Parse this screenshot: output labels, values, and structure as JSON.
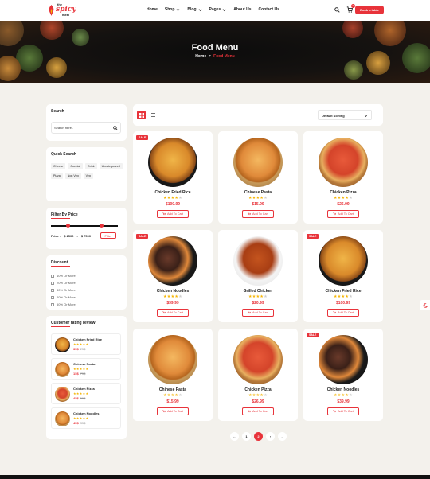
{
  "brand": {
    "line1": "the",
    "line2": "spicy",
    "line3": "meal"
  },
  "nav": [
    {
      "label": "Home",
      "dropdown": false
    },
    {
      "label": "Shop",
      "dropdown": true
    },
    {
      "label": "Blog",
      "dropdown": true
    },
    {
      "label": "Pages",
      "dropdown": true
    },
    {
      "label": "About Us",
      "dropdown": false
    },
    {
      "label": "Contact Us",
      "dropdown": false
    }
  ],
  "header": {
    "cart_count": "0",
    "book_label": "Book a table"
  },
  "hero": {
    "title": "Food Menu",
    "crumb_home": "Home",
    "crumb_sep": ">",
    "crumb_current": "Food Menu"
  },
  "sidebar": {
    "search": {
      "title": "Search",
      "placeholder": "Search here.."
    },
    "quick": {
      "title": "Quick Search",
      "tags": [
        "Cheese",
        "Cocktail",
        "Drink",
        "Uncategorized",
        "Pizza",
        "Non Veg",
        "Veg"
      ]
    },
    "price": {
      "title": "Filter By Price",
      "label": "Price :",
      "min": "$ 2500",
      "dash": "-",
      "max": "$ 7500",
      "min_fraction": 0.25,
      "max_fraction": 0.75,
      "button": "Filter"
    },
    "discount": {
      "title": "Discount",
      "items": [
        "10% Or More",
        "20% Or More",
        "30% Or More",
        "40% Or More",
        "50% Or More"
      ]
    },
    "rating": {
      "title": "Customer rating review",
      "items": [
        {
          "name": "Chicken Fried Rice",
          "stars": "★★★★★",
          "price": "35$",
          "old": "25$"
        },
        {
          "name": "Chinese Pasta",
          "stars": "★★★★★",
          "price": "15$",
          "old": "75$"
        },
        {
          "name": "Chicken Pizza",
          "stars": "★★★★★",
          "price": "45$",
          "old": "55$"
        },
        {
          "name": "Chicken Noodles",
          "stars": "★★★★★",
          "price": "45$",
          "old": "35$"
        }
      ]
    }
  },
  "toolbar": {
    "sort_label": "Default Sorting"
  },
  "products": [
    {
      "name": "Chicken Fried Rice",
      "price": "$100.99",
      "sale": "SALE",
      "rating": 4,
      "cart": "Add To Cart",
      "kind": "rice"
    },
    {
      "name": "Chinese Pasta",
      "price": "$15.99",
      "sale": "",
      "rating": 4,
      "cart": "Add To Cart",
      "kind": "pasta"
    },
    {
      "name": "Chicken Pizza",
      "price": "$26.99",
      "sale": "",
      "rating": 4,
      "cart": "Add To Cart",
      "kind": "pizza"
    },
    {
      "name": "Chicken Noodles",
      "price": "$39.99",
      "sale": "SALE",
      "rating": 4,
      "cart": "Add To Cart",
      "kind": "noodles"
    },
    {
      "name": "Grilled Chicken",
      "price": "$20.99",
      "sale": "",
      "rating": 4,
      "cart": "Add To Cart",
      "kind": "wings"
    },
    {
      "name": "Chicken Fried Rice",
      "price": "$100.99",
      "sale": "SALE",
      "rating": 4,
      "cart": "Add To Cart",
      "kind": "rice"
    },
    {
      "name": "Chinese Pasta",
      "price": "$15.99",
      "sale": "",
      "rating": 4,
      "cart": "Add To Cart",
      "kind": "pasta"
    },
    {
      "name": "Chicken Pizza",
      "price": "$26.99",
      "sale": "",
      "rating": 4,
      "cart": "Add To Cart",
      "kind": "pizza"
    },
    {
      "name": "Chicken Noodles",
      "price": "$39.99",
      "sale": "SALE",
      "rating": 4,
      "cart": "Add To Cart",
      "kind": "noodles"
    }
  ],
  "pagination": {
    "prev": "←",
    "pages": [
      "1",
      "2"
    ],
    "active": "2",
    "next_page": "›",
    "next": "→"
  },
  "colors": {
    "accent": "#e8333a",
    "star": "#f5b400",
    "page_bg": "#f3f1ec"
  }
}
